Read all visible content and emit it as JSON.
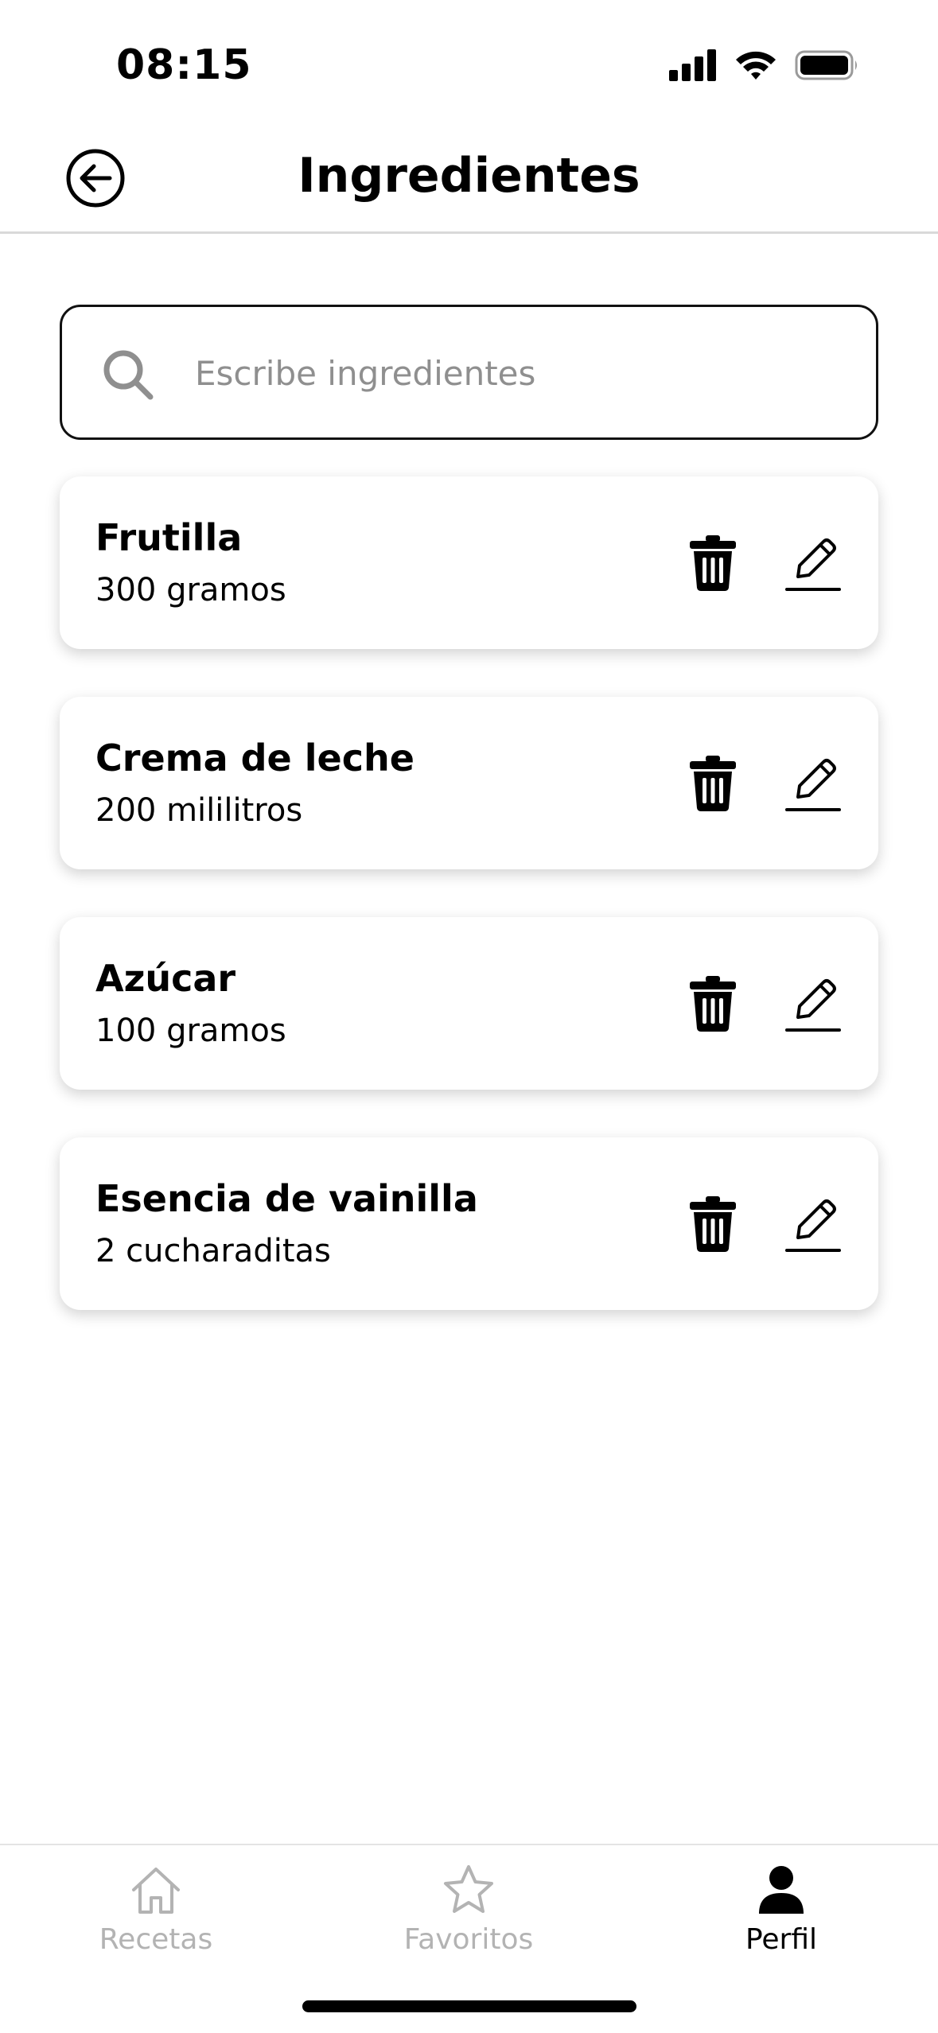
{
  "status_bar": {
    "time": "08:15",
    "icons": [
      "cellular-signal-icon",
      "wifi-icon",
      "battery-icon"
    ]
  },
  "header": {
    "title": "Ingredientes",
    "back_icon": "arrow-left-circle-icon"
  },
  "search": {
    "placeholder": "Escribe ingredientes",
    "value": "",
    "icon": "search-icon"
  },
  "ingredients": [
    {
      "name": "Frutilla",
      "quantity": "300 gramos"
    },
    {
      "name": "Crema de leche",
      "quantity": "200 mililitros"
    },
    {
      "name": "Azúcar",
      "quantity": "100 gramos"
    },
    {
      "name": "Esencia de vainilla",
      "quantity": "2 cucharaditas"
    }
  ],
  "item_actions": {
    "delete_icon": "trash-icon",
    "edit_icon": "pencil-icon"
  },
  "bottom_nav": {
    "items": [
      {
        "label": "Recetas",
        "icon": "home-icon",
        "active": false
      },
      {
        "label": "Favoritos",
        "icon": "star-icon",
        "active": false
      },
      {
        "label": "Perfil",
        "icon": "person-icon",
        "active": true
      }
    ]
  },
  "colors": {
    "text": "#000000",
    "inactive_nav": "#b3b3b3",
    "placeholder": "#8f8f8f",
    "divider": "#d9d9d9"
  }
}
